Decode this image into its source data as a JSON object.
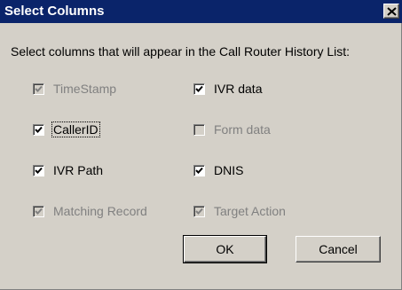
{
  "dialog": {
    "title": "Select Columns",
    "instruction": "Select columns that will appear in the Call Router History List:"
  },
  "checkboxes": {
    "timestamp": {
      "label": "TimeStamp",
      "checked": true,
      "enabled": false
    },
    "callerid": {
      "label": "CallerID",
      "checked": true,
      "enabled": true
    },
    "ivr_path": {
      "label": "IVR Path",
      "checked": true,
      "enabled": true
    },
    "matching_record": {
      "label": "Matching Record",
      "checked": true,
      "enabled": false
    },
    "ivr_data": {
      "label": "IVR data",
      "checked": true,
      "enabled": true
    },
    "form_data": {
      "label": "Form data",
      "checked": false,
      "enabled": false
    },
    "dnis": {
      "label": "DNIS",
      "checked": true,
      "enabled": true
    },
    "target_action": {
      "label": "Target Action",
      "checked": true,
      "enabled": false
    }
  },
  "buttons": {
    "ok_label": "OK",
    "cancel_label": "Cancel"
  },
  "icons": {
    "close": "close-x-icon",
    "check": "checkmark-icon"
  },
  "colors": {
    "titlebar": "#0a246a",
    "face": "#d4d0c8",
    "disabled_text": "#808080"
  }
}
